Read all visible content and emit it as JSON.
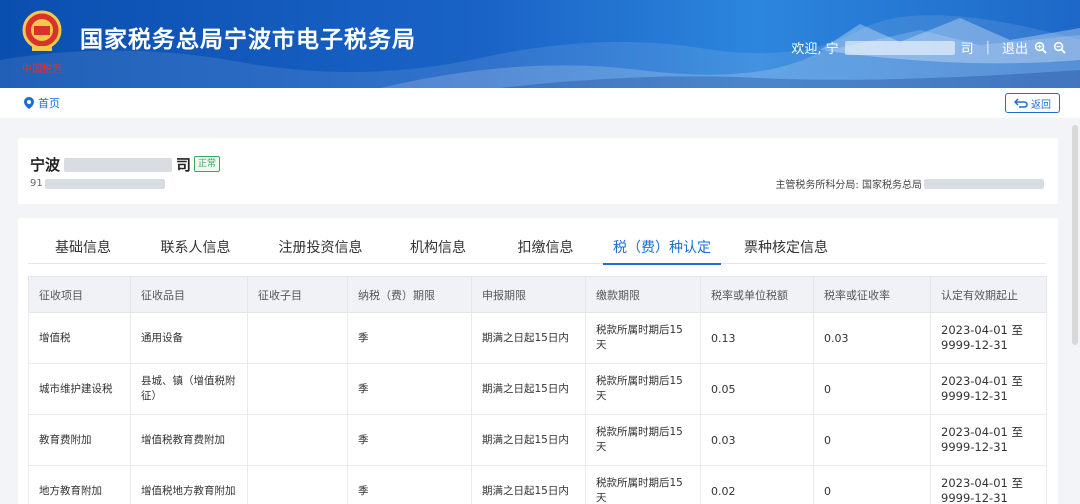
{
  "header": {
    "site_title": "国家税务总局宁波市电子税务局",
    "logo_caption": "中国税务",
    "welcome_prefix": "欢迎, 宁",
    "welcome_suffix": "司",
    "separator": "|",
    "logout": "退出",
    "zoom_in_icon": "zoom-in-icon",
    "zoom_out_icon": "zoom-out-icon"
  },
  "breadcrumb": {
    "home": "首页",
    "back": "返回"
  },
  "company": {
    "name_prefix": "宁波",
    "name_suffix": "司",
    "status": "正常",
    "tax_id_prefix": "91",
    "bureau_label": "主管税务所科分局: 国家税务总局"
  },
  "tabs": [
    {
      "label": "基础信息",
      "active": false
    },
    {
      "label": "联系人信息",
      "active": false
    },
    {
      "label": "注册投资信息",
      "active": false
    },
    {
      "label": "机构信息",
      "active": false
    },
    {
      "label": "扣缴信息",
      "active": false
    },
    {
      "label": "税（费）种认定",
      "active": true
    },
    {
      "label": "票种核定信息",
      "active": false
    }
  ],
  "table": {
    "headers": [
      "征收项目",
      "征收品目",
      "征收子目",
      "纳税（费）期限",
      "申报期限",
      "缴款期限",
      "税率或单位税额",
      "税率或征收率",
      "认定有效期起止"
    ],
    "rows": [
      [
        "增值税",
        "通用设备",
        "",
        "季",
        "期满之日起15日内",
        "税款所属时期后15天",
        "0.13",
        "0.03",
        "2023-04-01 至 9999-12-31"
      ],
      [
        "城市维护建设税",
        "县城、镇（增值税附征）",
        "",
        "季",
        "期满之日起15日内",
        "税款所属时期后15天",
        "0.05",
        "0",
        "2023-04-01 至 9999-12-31"
      ],
      [
        "教育费附加",
        "增值税教育费附加",
        "",
        "季",
        "期满之日起15日内",
        "税款所属时期后15天",
        "0.03",
        "0",
        "2023-04-01 至 9999-12-31"
      ],
      [
        "地方教育附加",
        "增值税地方教育附加",
        "",
        "季",
        "期满之日起15日内",
        "税款所属时期后15天",
        "0.02",
        "0",
        "2023-04-01 至 9999-12-31"
      ]
    ]
  },
  "colors": {
    "accent": "#1b6ed6",
    "header": "#1a63c6",
    "status_green": "#37a85d"
  }
}
